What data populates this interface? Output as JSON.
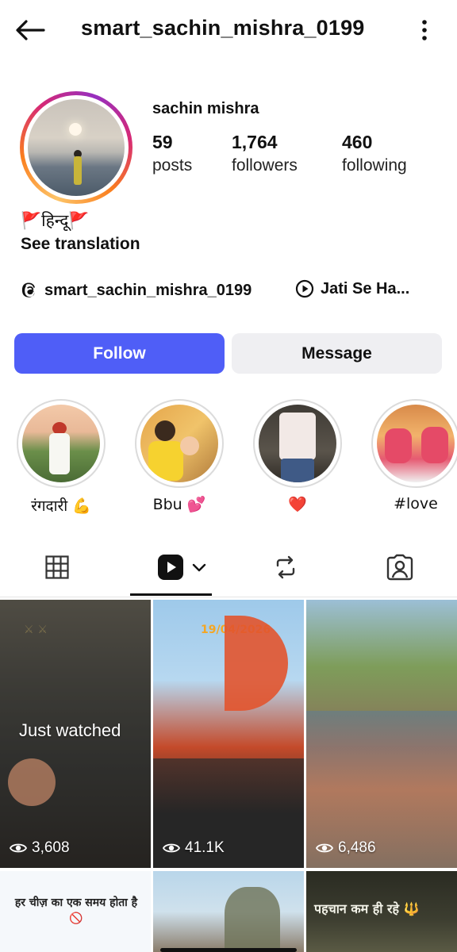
{
  "header": {
    "username": "smart_sachin_mishra_0199",
    "back_icon": "arrow-left-icon",
    "more_icon": "more-vertical-icon"
  },
  "profile": {
    "display_name": "sachin mishra",
    "stats": [
      {
        "value": "59",
        "label": "posts"
      },
      {
        "value": "1,764",
        "label": "followers"
      },
      {
        "value": "460",
        "label": "following"
      }
    ],
    "bio": "🚩हिन्दू🚩",
    "see_translation": "See translation",
    "threads_handle": "smart_sachin_mishra_0199",
    "music_link": "Jati Se Ha..."
  },
  "actions": {
    "follow_label": "Follow",
    "message_label": "Message"
  },
  "highlights": [
    {
      "label": "रंगदारी 💪"
    },
    {
      "label": "Bbu 💕"
    },
    {
      "label": "❤️"
    },
    {
      "label": "#love"
    }
  ],
  "tabs": [
    {
      "name": "grid",
      "icon": "grid-icon"
    },
    {
      "name": "reels",
      "icon": "reels-icon",
      "active": true
    },
    {
      "name": "reposts",
      "icon": "repost-icon"
    },
    {
      "name": "tagged",
      "icon": "tagged-person-icon"
    }
  ],
  "grid": {
    "just_watched": "Just watched",
    "tiles": [
      {
        "views": "3,608",
        "caption": ""
      },
      {
        "views": "41.1K",
        "caption": "19/04/2026"
      },
      {
        "views": "6,486",
        "caption": ""
      },
      {
        "views": "",
        "caption": "हर चीज़ का एक समय होता है 🚫"
      },
      {
        "views": "",
        "caption": ""
      },
      {
        "views": "",
        "caption": "पहचान कम ही रहे 🔱"
      }
    ]
  },
  "colors": {
    "follow_bg": "#4f5ef7",
    "message_bg": "#efeff2"
  }
}
